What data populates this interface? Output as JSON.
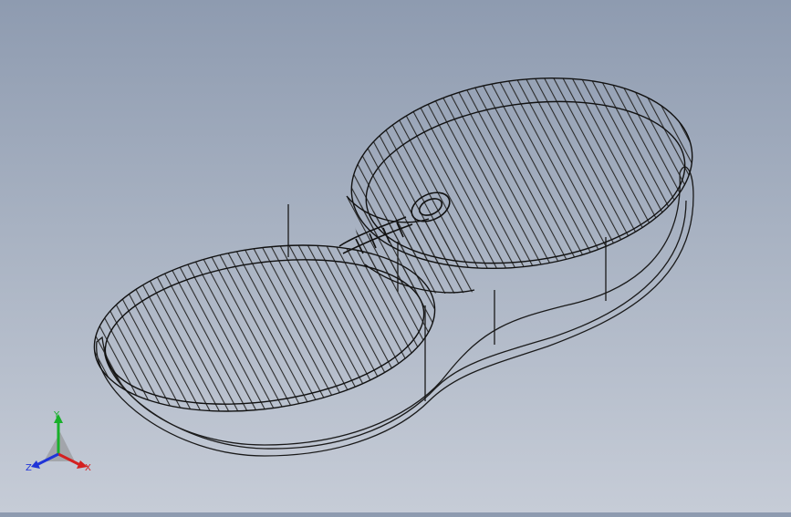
{
  "viewport": {
    "model_name": "",
    "line_color": "#1a1a1a",
    "background_top": "#8e9bb0",
    "background_bottom": "#c6ccd7"
  },
  "triad": {
    "x_label": "X",
    "y_label": "Y",
    "z_label": "Z",
    "x_color": "#d42020",
    "y_color": "#18b02a",
    "z_color": "#1f34d8"
  }
}
